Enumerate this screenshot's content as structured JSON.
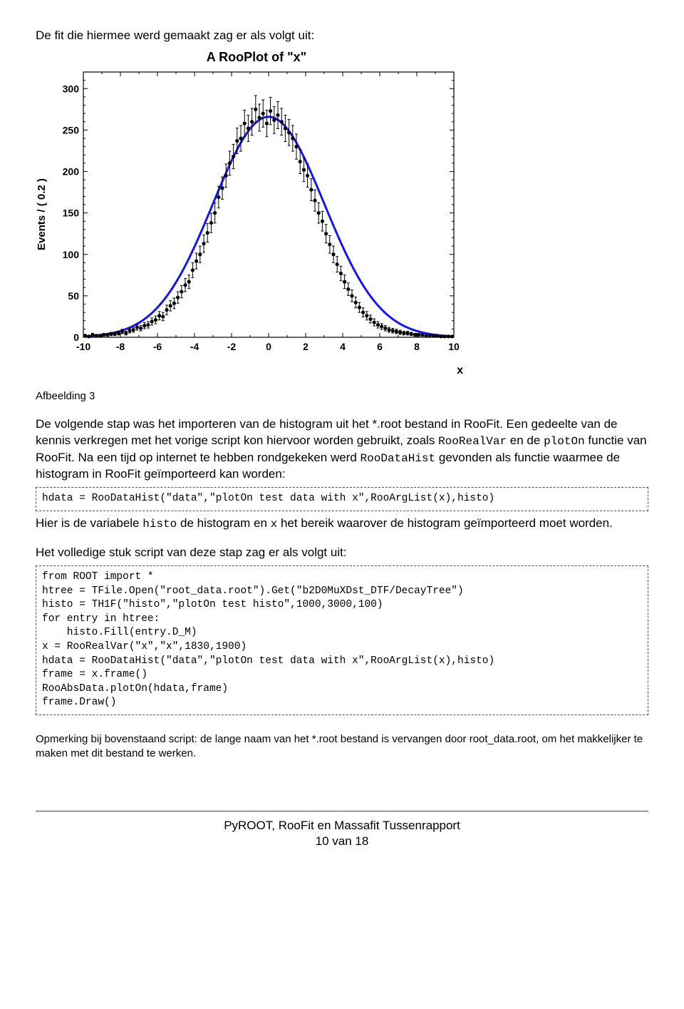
{
  "intro": "De fit die hiermee werd gemaakt zag er als volgt uit:",
  "caption": "Afbeelding 3",
  "chart_data": {
    "type": "scatter",
    "title": "A RooPlot of \"x\"",
    "xlabel": "x",
    "ylabel": "Events / ( 0.2 )",
    "xlim": [
      -10,
      10
    ],
    "ylim": [
      0,
      320
    ],
    "xticks": [
      -10,
      -8,
      -6,
      -4,
      -2,
      0,
      2,
      4,
      6,
      8,
      10
    ],
    "yticks": [
      0,
      50,
      100,
      150,
      200,
      250,
      300
    ],
    "series": [
      {
        "name": "data",
        "kind": "errorbar",
        "x": [
          -9.9,
          -9.7,
          -9.5,
          -9.3,
          -9.1,
          -8.9,
          -8.7,
          -8.5,
          -8.3,
          -8.1,
          -7.9,
          -7.7,
          -7.5,
          -7.3,
          -7.1,
          -6.9,
          -6.7,
          -6.5,
          -6.3,
          -6.1,
          -5.9,
          -5.7,
          -5.5,
          -5.3,
          -5.1,
          -4.9,
          -4.7,
          -4.5,
          -4.3,
          -4.1,
          -3.9,
          -3.7,
          -3.5,
          -3.3,
          -3.1,
          -2.9,
          -2.7,
          -2.5,
          -2.3,
          -2.1,
          -1.9,
          -1.7,
          -1.5,
          -1.3,
          -1.1,
          -0.9,
          -0.7,
          -0.5,
          -0.3,
          -0.1,
          0.1,
          0.3,
          0.5,
          0.7,
          0.9,
          1.1,
          1.3,
          1.5,
          1.7,
          1.9,
          2.1,
          2.3,
          2.5,
          2.7,
          2.9,
          3.1,
          3.3,
          3.5,
          3.7,
          3.9,
          4.1,
          4.3,
          4.5,
          4.7,
          4.9,
          5.1,
          5.3,
          5.5,
          5.7,
          5.9,
          6.1,
          6.3,
          6.5,
          6.7,
          6.9,
          7.1,
          7.3,
          7.5,
          7.7,
          7.9,
          8.1,
          8.3,
          8.5,
          8.7,
          8.9,
          9.1,
          9.3,
          9.5,
          9.7,
          9.9
        ],
        "y": [
          2,
          1,
          3,
          2,
          2,
          3,
          3,
          4,
          4,
          5,
          7,
          5,
          8,
          9,
          12,
          11,
          14,
          15,
          19,
          21,
          26,
          25,
          33,
          38,
          41,
          48,
          55,
          63,
          67,
          81,
          92,
          100,
          113,
          126,
          138,
          150,
          169,
          180,
          195,
          210,
          218,
          237,
          240,
          258,
          252,
          260,
          275,
          265,
          270,
          258,
          273,
          262,
          268,
          260,
          252,
          247,
          240,
          230,
          212,
          202,
          195,
          178,
          165,
          150,
          140,
          125,
          112,
          100,
          88,
          77,
          67,
          58,
          50,
          42,
          36,
          30,
          26,
          22,
          18,
          15,
          13,
          11,
          9,
          8,
          7,
          6,
          5,
          5,
          4,
          3,
          3,
          3,
          2,
          2,
          2,
          2,
          1,
          1,
          1,
          1
        ]
      },
      {
        "name": "fit",
        "kind": "line",
        "color": "#1414ff",
        "function": "gaussian",
        "params": {
          "A": 266,
          "mu": 0.0,
          "sigma": 3.0
        }
      }
    ]
  },
  "para1_a": "De volgende stap was het importeren van de histogram uit het *.root bestand in RooFit. Een gedeelte van de kennis verkregen met het vorige script kon hiervoor worden gebruikt, zoals ",
  "para1_code1": "RooRealVar",
  "para1_b": " en de ",
  "para1_code2": "plotOn",
  "para1_c": " functie van RooFit. Na een tijd op internet te hebben rondgekeken werd ",
  "para1_code3": "RooDataHist",
  "para1_d": " gevonden als functie waarmee de histogram in RooFit geïmporteerd kan worden:",
  "code1": "hdata = RooDataHist(\"data\",\"plotOn test data with x\",RooArgList(x),histo)",
  "para2_a": "Hier is de variabele ",
  "para2_code1": "histo",
  "para2_b": " de histogram en ",
  "para2_code2": "x",
  "para2_c": " het bereik waarover de histogram geïmporteerd moet worden.",
  "para3": "Het volledige stuk script van deze stap zag er als volgt uit:",
  "code2": "from ROOT import *\nhtree = TFile.Open(\"root_data.root\").Get(\"b2D0MuXDst_DTF/DecayTree\")\nhisto = TH1F(\"histo\",\"plotOn test histo\",1000,3000,100)\nfor entry in htree:\n    histo.Fill(entry.D_M)\nx = RooRealVar(\"x\",\"x\",1830,1900)\nhdata = RooDataHist(\"data\",\"plotOn test data with x\",RooArgList(x),histo)\nframe = x.frame()\nRooAbsData.plotOn(hdata,frame)\nframe.Draw()",
  "note": "Opmerking bij bovenstaand script: de lange naam van het *.root bestand is vervangen door root_data.root, om het makkelijker te maken met dit bestand te werken.",
  "footer1": "PyROOT, RooFit en Massafit Tussenrapport",
  "footer2": "10 van 18"
}
